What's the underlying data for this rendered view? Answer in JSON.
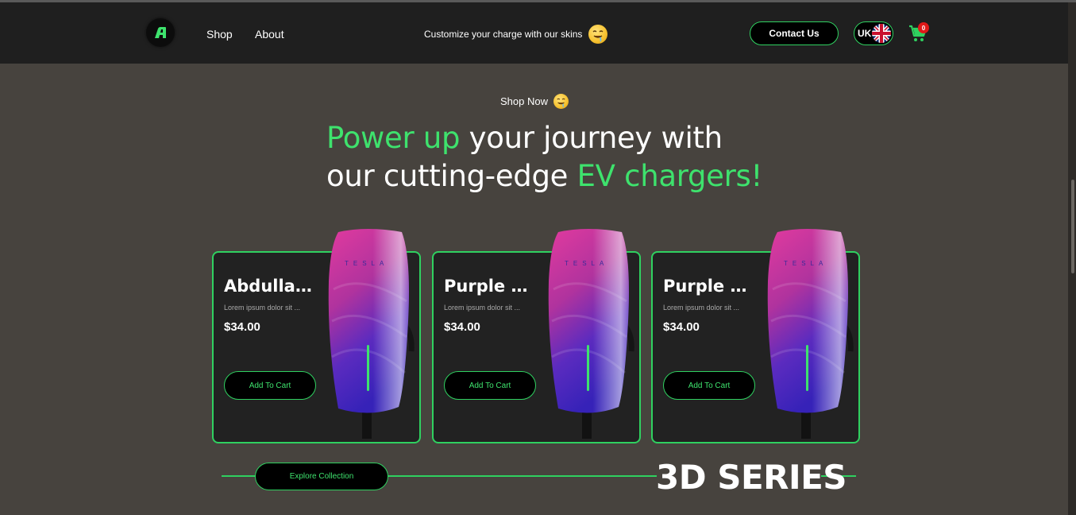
{
  "nav": {
    "links": [
      "Shop",
      "About"
    ],
    "promo_text": "Customize your charge with our skins",
    "contact_label": "Contact Us",
    "language": "UK",
    "cart_count": "0"
  },
  "hero": {
    "shop_now": "Shop Now",
    "headline_part1": "Power up",
    "headline_part2": " your journey with",
    "headline_part3": "our cutting-edge ",
    "headline_part4": "EV chargers!"
  },
  "products": [
    {
      "title": "Abdullah...",
      "desc": "Lorem ipsum dolor sit ...",
      "price": "$34.00",
      "button": "Add To Cart",
      "brand": "TESLA"
    },
    {
      "title": "Purple Sky",
      "desc": "Lorem ipsum dolor sit ...",
      "price": "$34.00",
      "button": "Add To Cart",
      "brand": "TESLA"
    },
    {
      "title": "Purple Sky",
      "desc": "Lorem ipsum dolor sit ...",
      "price": "$34.00",
      "button": "Add To Cart",
      "brand": "TESLA"
    }
  ],
  "series": {
    "explore_label": "Explore Collection",
    "title": "3D SERIES"
  },
  "colors": {
    "accent": "#3ee26d",
    "background": "#47433e",
    "navbar": "#1f1f1f",
    "card": "#222222",
    "badge": "#e01818"
  },
  "icons": {
    "logo": "brand-logo-icon",
    "emoji": "drooling-face-emoji-icon",
    "flag": "uk-flag-icon",
    "cart": "shopping-cart-icon"
  }
}
